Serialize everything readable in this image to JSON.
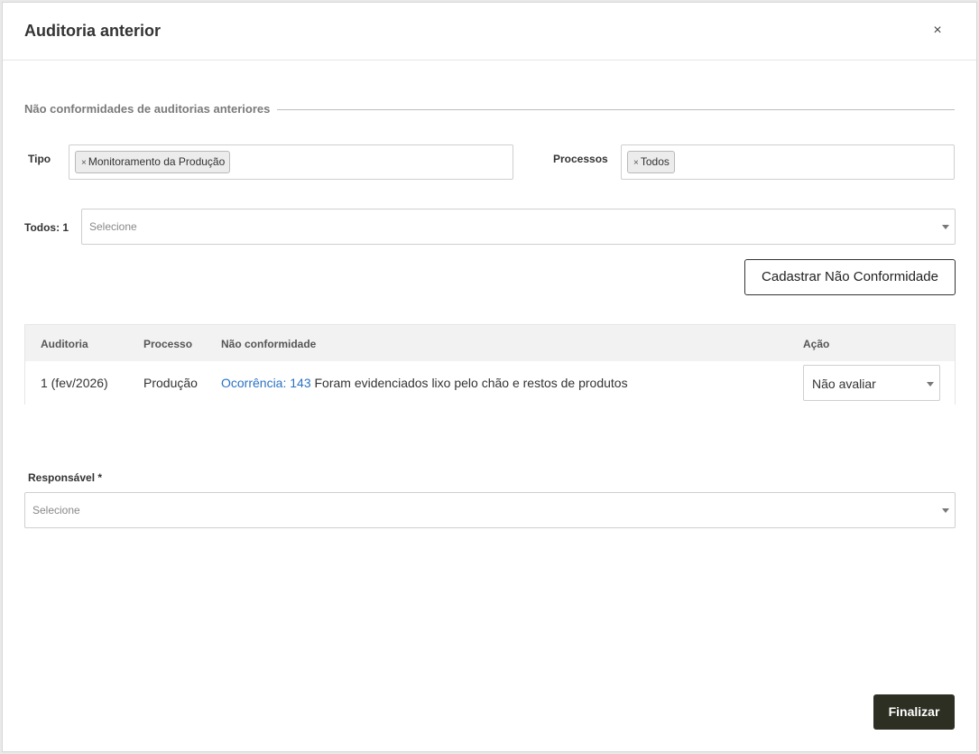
{
  "modal": {
    "title": "Auditoria anterior",
    "close_label": "×"
  },
  "section": {
    "label": "Não conformidades de auditorias anteriores"
  },
  "filters": {
    "tipo_label": "Tipo",
    "tipo_tags": [
      "Monitoramento da Produção"
    ],
    "processos_label": "Processos",
    "processos_tags": [
      "Todos"
    ],
    "tag_remove": "×",
    "todos_label": "Todos: 1",
    "todos_placeholder": "Selecione"
  },
  "actions": {
    "register_label": "Cadastrar Não Conformidade",
    "finish_label": "Finalizar"
  },
  "table": {
    "headers": [
      "Auditoria",
      "Processo",
      "Não conformidade",
      "Ação"
    ],
    "rows": [
      {
        "auditoria": "1 (fev/2026)",
        "processo": "Produção",
        "occurrence_link": "Ocorrência: 143",
        "description": "Foram evidenciados lixo pelo chão e restos de produtos",
        "acao": "Não avaliar"
      }
    ]
  },
  "responsavel": {
    "label": "Responsável *",
    "placeholder": "Selecione"
  }
}
